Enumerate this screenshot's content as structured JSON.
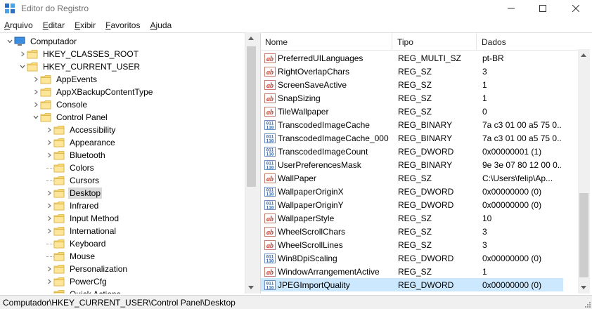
{
  "window": {
    "title": "Editor do Registro",
    "min_glyph": "—",
    "max_glyph": "☐",
    "close_glyph": "✕"
  },
  "menu": [
    {
      "accel": "A",
      "rest": "rquivo"
    },
    {
      "accel": "E",
      "rest": "ditar"
    },
    {
      "accel": "E",
      "rest": "xibir"
    },
    {
      "accel": "F",
      "rest": "avoritos"
    },
    {
      "accel": "A",
      "rest": "juda"
    }
  ],
  "tree": [
    {
      "label": "Computador",
      "level": 0,
      "expanded": true,
      "icon": "computer-icon"
    },
    {
      "label": "HKEY_CLASSES_ROOT",
      "level": 1,
      "expanded": false,
      "icon": "folder-icon"
    },
    {
      "label": "HKEY_CURRENT_USER",
      "level": 1,
      "expanded": true,
      "icon": "folder-icon"
    },
    {
      "label": "AppEvents",
      "level": 2,
      "expanded": false,
      "icon": "folder-icon"
    },
    {
      "label": "AppXBackupContentType",
      "level": 2,
      "expanded": false,
      "icon": "folder-icon"
    },
    {
      "label": "Console",
      "level": 2,
      "expanded": false,
      "icon": "folder-icon"
    },
    {
      "label": "Control Panel",
      "level": 2,
      "expanded": true,
      "icon": "folder-icon"
    },
    {
      "label": "Accessibility",
      "level": 3,
      "expanded": false,
      "icon": "folder-icon"
    },
    {
      "label": "Appearance",
      "level": 3,
      "expanded": false,
      "icon": "folder-icon"
    },
    {
      "label": "Bluetooth",
      "level": 3,
      "expanded": false,
      "icon": "folder-icon"
    },
    {
      "label": "Colors",
      "level": 3,
      "leaf": true,
      "icon": "folder-icon"
    },
    {
      "label": "Cursors",
      "level": 3,
      "leaf": true,
      "icon": "folder-icon"
    },
    {
      "label": "Desktop",
      "level": 3,
      "expanded": false,
      "selected": true,
      "icon": "folder-icon"
    },
    {
      "label": "Infrared",
      "level": 3,
      "expanded": false,
      "icon": "folder-icon"
    },
    {
      "label": "Input Method",
      "level": 3,
      "expanded": false,
      "icon": "folder-icon"
    },
    {
      "label": "International",
      "level": 3,
      "expanded": false,
      "icon": "folder-icon"
    },
    {
      "label": "Keyboard",
      "level": 3,
      "leaf": true,
      "icon": "folder-icon"
    },
    {
      "label": "Mouse",
      "level": 3,
      "leaf": true,
      "icon": "folder-icon"
    },
    {
      "label": "Personalization",
      "level": 3,
      "expanded": false,
      "icon": "folder-icon"
    },
    {
      "label": "PowerCfg",
      "level": 3,
      "expanded": false,
      "icon": "folder-icon"
    },
    {
      "label": "Quick Actions",
      "level": 3,
      "leaf": true,
      "icon": "folder-icon"
    }
  ],
  "list": {
    "headers": {
      "name": "Nome",
      "type": "Tipo",
      "data": "Dados"
    },
    "rows": [
      {
        "name": "PreferredUILanguages",
        "type": "REG_MULTI_SZ",
        "data": "pt-BR",
        "icon": "string-value-icon"
      },
      {
        "name": "RightOverlapChars",
        "type": "REG_SZ",
        "data": "3",
        "icon": "string-value-icon"
      },
      {
        "name": "ScreenSaveActive",
        "type": "REG_SZ",
        "data": "1",
        "icon": "string-value-icon"
      },
      {
        "name": "SnapSizing",
        "type": "REG_SZ",
        "data": "1",
        "icon": "string-value-icon"
      },
      {
        "name": "TileWallpaper",
        "type": "REG_SZ",
        "data": "0",
        "icon": "string-value-icon"
      },
      {
        "name": "TranscodedImageCache",
        "type": "REG_BINARY",
        "data": "7a c3 01 00 a5 75 0...",
        "icon": "binary-value-icon"
      },
      {
        "name": "TranscodedImageCache_000",
        "type": "REG_BINARY",
        "data": "7a c3 01 00 a5 75 0...",
        "icon": "binary-value-icon"
      },
      {
        "name": "TranscodedImageCount",
        "type": "REG_DWORD",
        "data": "0x00000001 (1)",
        "icon": "binary-value-icon"
      },
      {
        "name": "UserPreferencesMask",
        "type": "REG_BINARY",
        "data": "9e 3e 07 80 12 00 0...",
        "icon": "binary-value-icon"
      },
      {
        "name": "WallPaper",
        "type": "REG_SZ",
        "data": "C:\\Users\\felip\\Ap...",
        "icon": "string-value-icon"
      },
      {
        "name": "WallpaperOriginX",
        "type": "REG_DWORD",
        "data": "0x00000000 (0)",
        "icon": "binary-value-icon"
      },
      {
        "name": "WallpaperOriginY",
        "type": "REG_DWORD",
        "data": "0x00000000 (0)",
        "icon": "binary-value-icon"
      },
      {
        "name": "WallpaperStyle",
        "type": "REG_SZ",
        "data": "10",
        "icon": "string-value-icon"
      },
      {
        "name": "WheelScrollChars",
        "type": "REG_SZ",
        "data": "3",
        "icon": "string-value-icon"
      },
      {
        "name": "WheelScrollLines",
        "type": "REG_SZ",
        "data": "3",
        "icon": "string-value-icon"
      },
      {
        "name": "Win8DpiScaling",
        "type": "REG_DWORD",
        "data": "0x00000000 (0)",
        "icon": "binary-value-icon"
      },
      {
        "name": "WindowArrangementActive",
        "type": "REG_SZ",
        "data": "1",
        "icon": "string-value-icon"
      },
      {
        "name": "JPEGImportQuality",
        "type": "REG_DWORD",
        "data": "0x00000000 (0)",
        "icon": "binary-value-icon",
        "selected": true
      }
    ]
  },
  "status": {
    "path": "Computador\\HKEY_CURRENT_USER\\Control Panel\\Desktop"
  },
  "colors": {
    "selection_list": "#cce8ff",
    "selection_tree": "#d9d9d9",
    "folder": "#f8d775",
    "string_icon": "#c0392b",
    "binary_icon": "#2b5fa8"
  }
}
